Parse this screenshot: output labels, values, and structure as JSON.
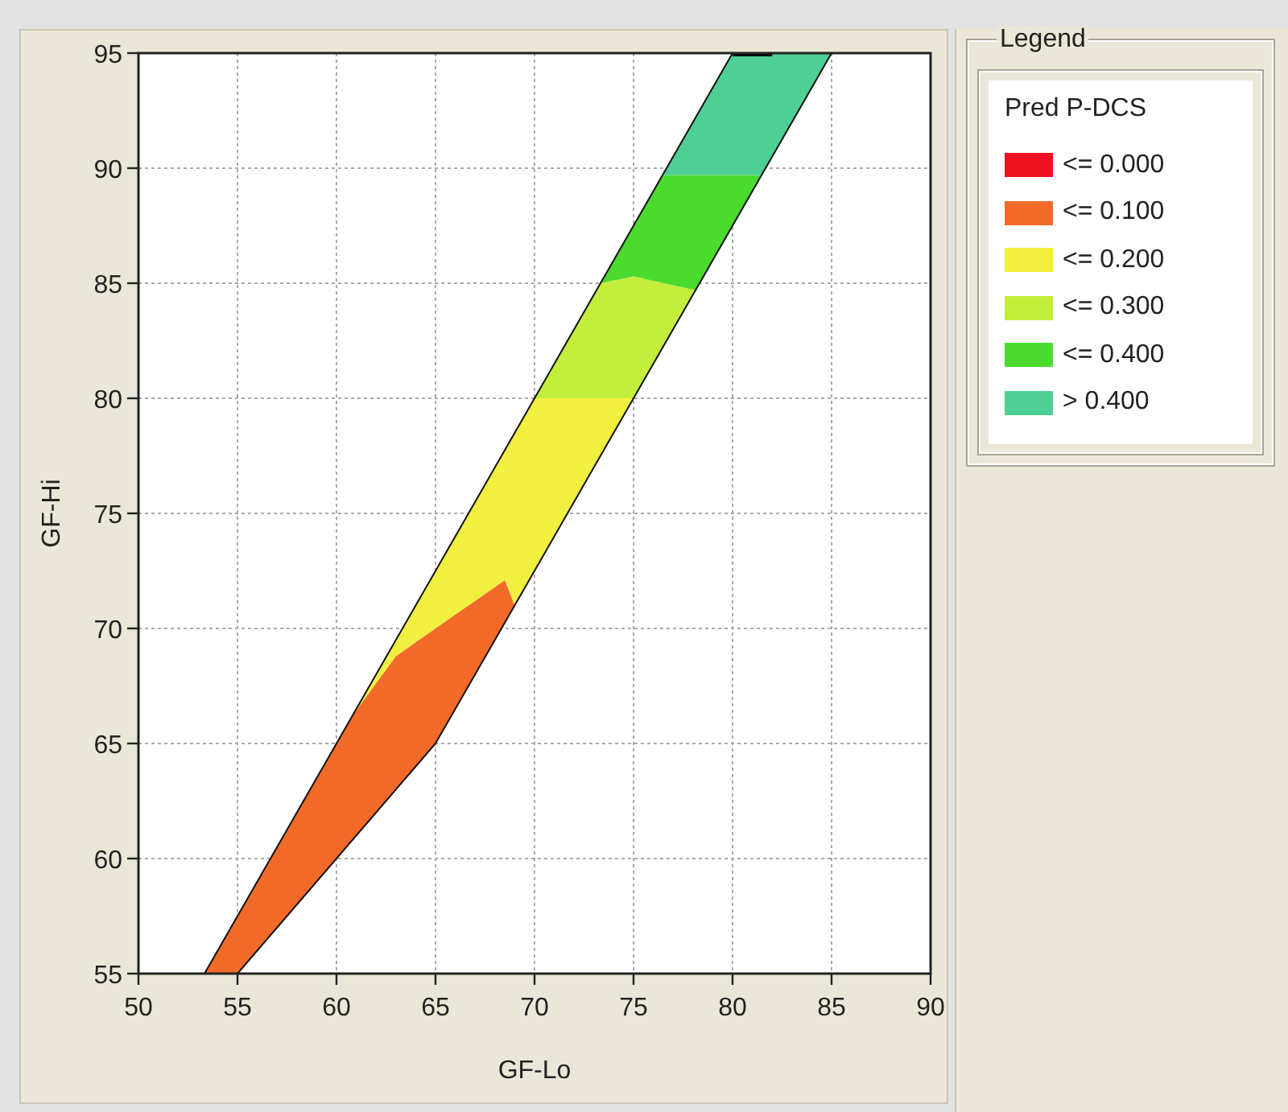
{
  "chart": {
    "y_axis_title": "GF-Hi",
    "x_axis_title": "GF-Lo",
    "y_tick_labels": [
      "95",
      "90",
      "85",
      "80",
      "75",
      "70",
      "65",
      "60",
      "55"
    ],
    "x_tick_labels": [
      "50",
      "55",
      "60",
      "65",
      "70",
      "75",
      "80",
      "85",
      "90"
    ]
  },
  "legend": {
    "title": "Legend",
    "heading": "Pred P-DCS",
    "items": [
      {
        "label": "<= 0.000",
        "color": "#ee1122"
      },
      {
        "label": "<= 0.100",
        "color": "#f26a2a"
      },
      {
        "label": "<= 0.200",
        "color": "#f1ef3f"
      },
      {
        "label": "<= 0.300",
        "color": "#c3ee3b"
      },
      {
        "label": "<= 0.400",
        "color": "#4bdb2f"
      },
      {
        "label": "> 0.400",
        "color": "#4ecf93"
      }
    ]
  }
}
